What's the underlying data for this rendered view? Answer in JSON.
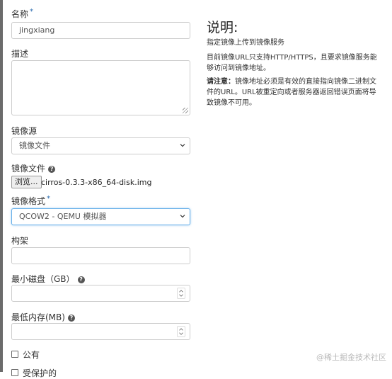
{
  "form": {
    "name_label": "名称",
    "required_mark": "*",
    "name_value": "jingxiang",
    "description_label": "描述",
    "image_source_label": "镜像源",
    "image_source_value": "镜像文件",
    "image_file_label": "镜像文件",
    "browse_label": "浏览...",
    "file_name": "cirros-0.3.3-x86_64-disk.img",
    "image_format_label": "镜像格式",
    "image_format_value": "QCOW2 - QEMU 模拟器",
    "architecture_label": "构架",
    "min_disk_label": "最小磁盘（GB）",
    "min_ram_label": "最低内存(MB)",
    "public_label": "公有",
    "protected_label": "受保护的"
  },
  "help": {
    "title": "说明:",
    "line1": "指定镜像上传到镜像服务",
    "line2": "目前镜像URL只支持HTTP/HTTPS，且要求镜像服务能够访问到镜像地址。",
    "note_label": "请注意：",
    "note_text": "镜像地址必须是有效的直接指向镜像二进制文件的URL。URL被重定向或者服务器返回错误页面将导致镜像不可用。"
  },
  "watermark": "@稀土掘金技术社区",
  "icons": {
    "help": "question-circle-icon",
    "select": "chevron-down-icon",
    "spinner": "spinner-arrows-icon"
  },
  "colors": {
    "required": "#2b6cb0",
    "focus_border": "#66afe9"
  }
}
